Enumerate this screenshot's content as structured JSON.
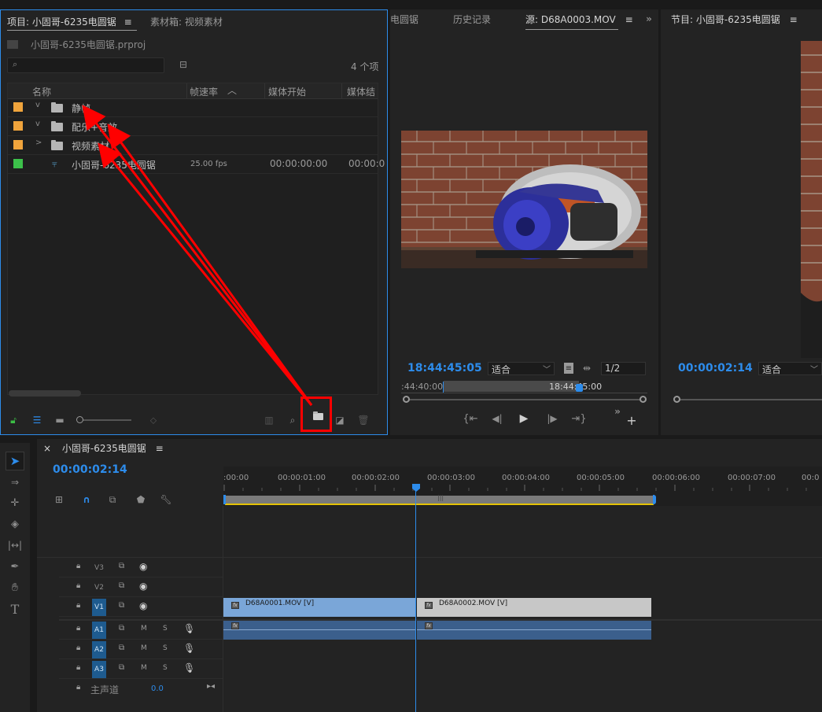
{
  "project": {
    "tab_title": "项目: 小固哥-6235电圆锯",
    "tab_bin": "素材箱: 视频素材",
    "project_file": "小固哥-6235电圆锯.prproj",
    "item_count": "4 个项",
    "columns": [
      "名称",
      "帧速率",
      "媒体开始",
      "媒体结"
    ],
    "items": [
      {
        "name": "静帧",
        "type": "folder",
        "expand": "v",
        "color": "#f0a43c",
        "fps": "",
        "start": "",
        "end": ""
      },
      {
        "name": "配乐+音效",
        "type": "folder",
        "expand": "v",
        "color": "#f0a43c",
        "fps": "",
        "start": "",
        "end": ""
      },
      {
        "name": "视频素材",
        "type": "folder",
        "expand": ">",
        "color": "#f0a43c",
        "fps": "",
        "start": "",
        "end": ""
      },
      {
        "name": "小固哥-6235电圆锯",
        "type": "sequence",
        "expand": "",
        "color": "#3cc04a",
        "fps": "25.00 fps",
        "start": "00:00:00:00",
        "end": "00:00:0"
      }
    ]
  },
  "source_monitor": {
    "tab_partial": "电圆锯",
    "tab_history": "历史记录",
    "tab_source": "源: D68A0003.MOV",
    "timecode": "18:44:45:05",
    "fit": "适合",
    "resolution": "1/2",
    "ruler_left": ":44:40:00",
    "ruler_right": "18:44:45:00"
  },
  "program_monitor": {
    "tab_title": "节目: 小固哥-6235电圆锯",
    "timecode": "00:00:02:14",
    "fit": "适合"
  },
  "timeline": {
    "sequence_name": "小固哥-6235电圆锯",
    "timecode": "00:00:02:14",
    "ruler": [
      ":00:00",
      "00:00:01:00",
      "00:00:02:00",
      "00:00:03:00",
      "00:00:04:00",
      "00:00:05:00",
      "00:00:06:00",
      "00:00:07:00",
      "00:0"
    ],
    "video_tracks": [
      "V3",
      "V2",
      "V1"
    ],
    "audio_tracks": [
      "A1",
      "A2",
      "A3"
    ],
    "source_v": "V1",
    "source_a": "A1",
    "mute": "M",
    "solo": "S",
    "master_label": "主声道",
    "master_value": "0.0",
    "clip1": "D68A0001.MOV [V]",
    "clip2": "D68A0002.MOV [V]",
    "fx": "fx",
    "menu_glyph": "≡",
    "close_glyph": "×"
  },
  "colors": {
    "accent": "#2d8ceb",
    "annotation": "#ff0000",
    "clip1": "#7aa6d8",
    "clip2": "#c7c7c7",
    "audio": "#3b5f8c"
  }
}
